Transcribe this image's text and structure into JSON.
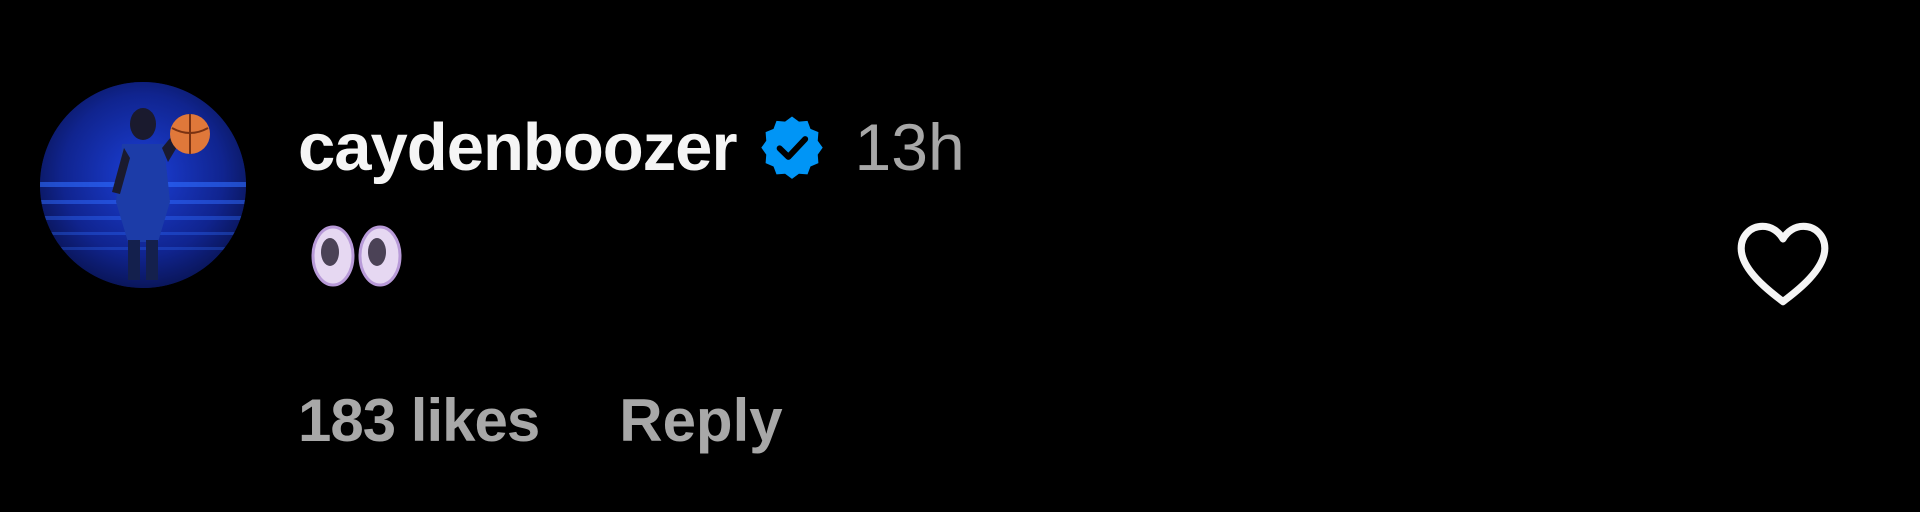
{
  "comment": {
    "username": "caydenboozer",
    "verified": true,
    "timestamp": "13h",
    "body_emoji": "eyes",
    "likes_text": "183 likes",
    "reply_label": "Reply"
  },
  "icons": {
    "verified": "verified-badge-icon",
    "like": "heart-outline-icon",
    "avatar": "profile-avatar"
  },
  "colors": {
    "background": "#000000",
    "username": "#f5f5f5",
    "secondary_text": "#a8a8a8",
    "verified_badge": "#0095f6",
    "heart_outline": "#f5f5f5"
  }
}
